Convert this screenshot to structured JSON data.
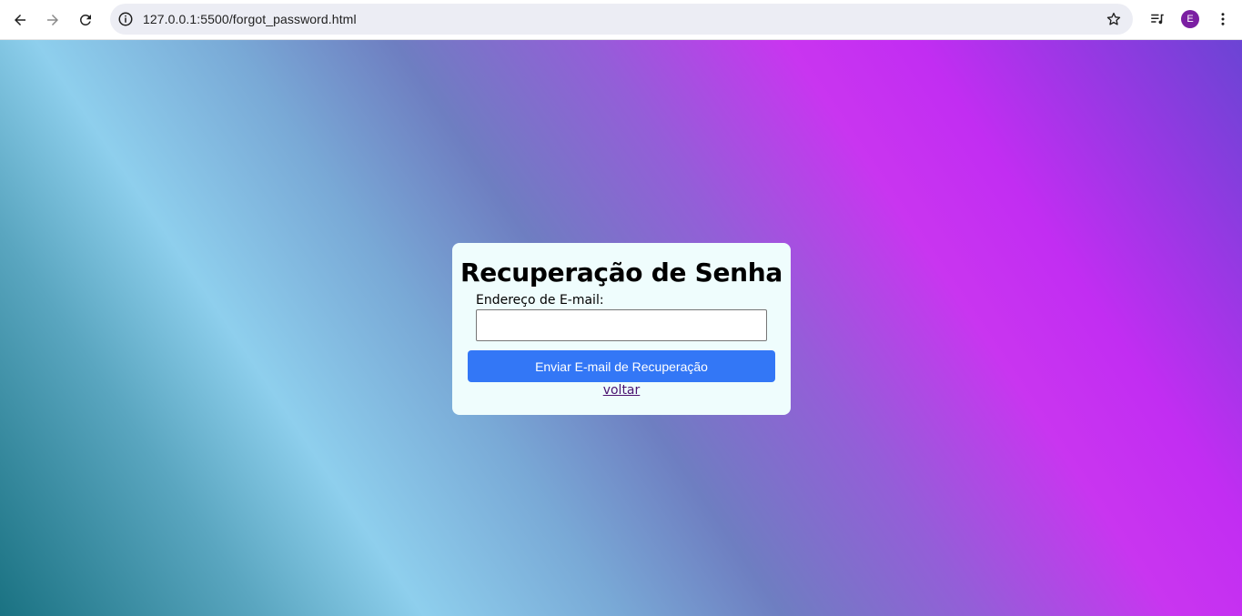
{
  "browser": {
    "url": "127.0.0.1:5500/forgot_password.html",
    "profile_initial": "E",
    "icons": {
      "back": "arrow-left-icon",
      "forward": "arrow-right-icon",
      "reload": "reload-icon",
      "site_info": "info-icon",
      "bookmark": "star-icon",
      "media": "media-queue-icon",
      "menu": "kebab-menu-icon"
    }
  },
  "page": {
    "title": "Recuperação de Senha",
    "email_label": "Endereço de E-mail:",
    "email_value": "",
    "email_placeholder": "",
    "submit_label": "Enviar E-mail de Recuperação",
    "back_link_label": "voltar"
  },
  "colors": {
    "card_background": "#effdfd",
    "button_background": "#3377f6",
    "link_color": "#4b1270",
    "avatar_background": "#7b1fa2"
  }
}
